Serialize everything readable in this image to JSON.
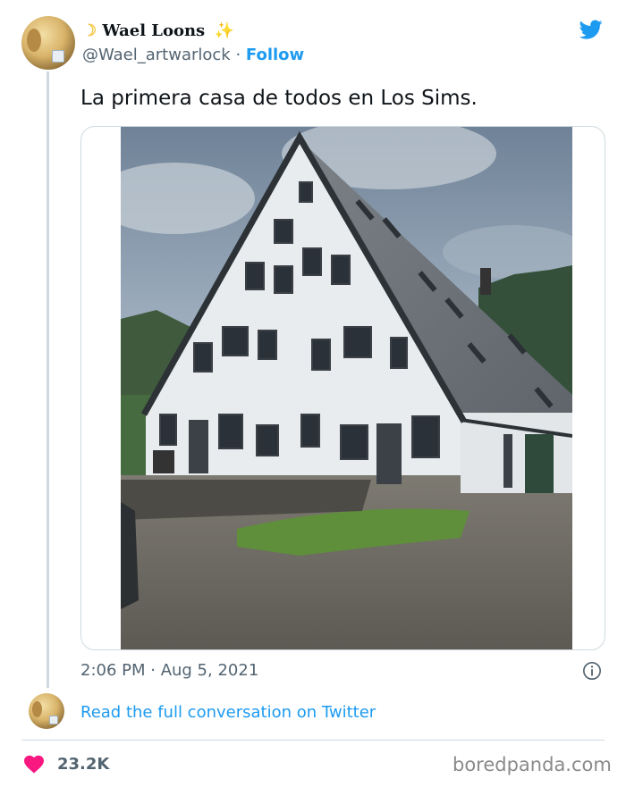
{
  "tweet": {
    "display_name": "Wael Loons",
    "display_name_prefix_emoji": "crescent-moon",
    "display_name_suffix_emoji": "sparkles",
    "handle": "@Wael_artwarlock",
    "separator": " · ",
    "follow_label": "Follow",
    "text": "La primera casa de todos en Los Sims.",
    "timestamp": "2:06 PM · Aug 5, 2021",
    "read_more_label": "Read the full conversation on Twitter",
    "like_count": "23.2K"
  },
  "icons": {
    "brand": "twitter-bird-icon",
    "info": "info-icon",
    "like": "heart-icon"
  },
  "watermark": "boredpanda.com",
  "colors": {
    "link_blue": "#1d9bf0",
    "heart_pink": "#f91880",
    "text_primary": "#0f1419",
    "text_secondary": "#536471",
    "border": "#cfd9de"
  }
}
